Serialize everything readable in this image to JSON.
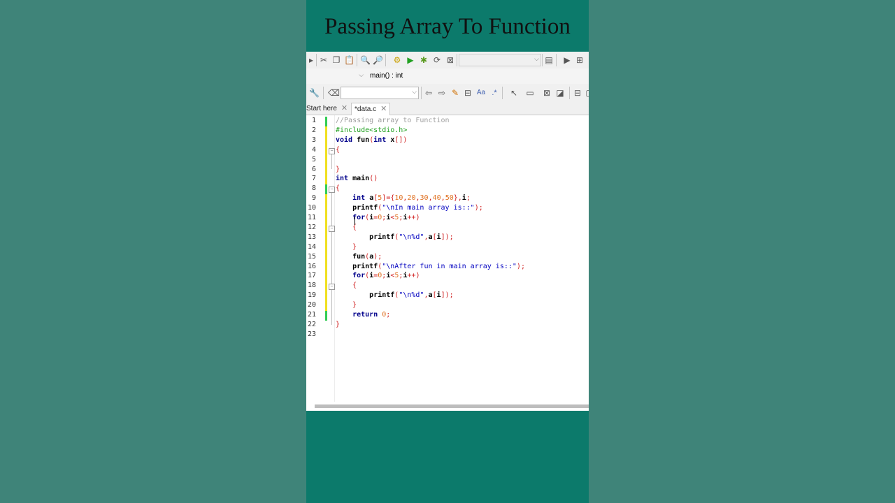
{
  "title": "Passing Array To Function",
  "toolbar": {
    "scope_value": "",
    "function_value": "main() : int",
    "search_value": ""
  },
  "tabs": [
    {
      "label": "Start here",
      "close": "✕"
    },
    {
      "label": "*data.c",
      "close": "✕"
    }
  ],
  "editor": {
    "line_numbers": [
      "1",
      "2",
      "3",
      "4",
      "5",
      "6",
      "7",
      "8",
      "9",
      "10",
      "11",
      "12",
      "13",
      "14",
      "15",
      "16",
      "17",
      "18",
      "19",
      "20",
      "21",
      "22",
      "23"
    ],
    "lines": [
      "//Passing array to Function",
      "#include<stdio.h>",
      "void fun(int x[])",
      "{",
      "    ",
      "}",
      "int main()",
      "{",
      "    int a[5]={10,20,30,40,50},i;",
      "    printf(\"\\nIn main array is::\");",
      "    for(i=0;i<5;i++)",
      "    {",
      "        printf(\"\\n%d\",a[i]);",
      "    }",
      "    fun(a);",
      "    printf(\"\\nAfter fun in main array is::\");",
      "    for(i=0;i<5;i++)",
      "    {",
      "        printf(\"\\n%d\",a[i]);",
      "    }",
      "    return 0;",
      "}",
      ""
    ]
  },
  "colors": {
    "page_bg": "#3f8479",
    "center_bg": "#0c7a6b",
    "change_saved": "#33cc55",
    "change_unsaved": "#f0e020"
  }
}
